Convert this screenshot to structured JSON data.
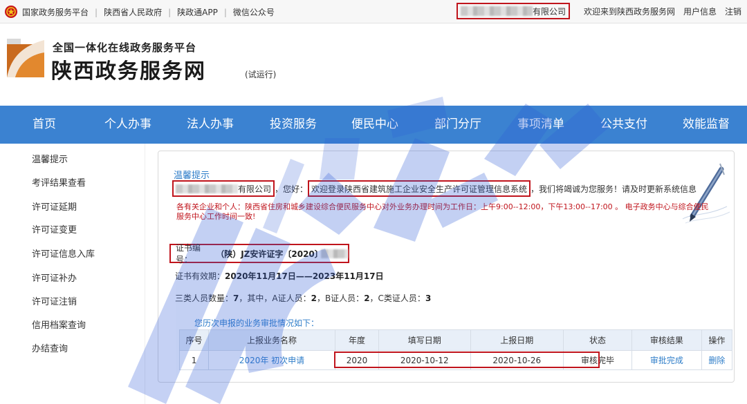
{
  "topbar": {
    "links": [
      "国家政务服务平台",
      "陕西省人民政府",
      "陕政通APP",
      "微信公众号"
    ],
    "company_suffix": "有限公司",
    "welcome": "欢迎来到陕西政务服务网",
    "user_info": "用户信息",
    "logout": "注销"
  },
  "header": {
    "slogan": "全国一体化在线政务服务平台",
    "site_name": "陕西政务服务网",
    "trial": "(试运行)"
  },
  "nav": {
    "items": [
      "首页",
      "个人办事",
      "法人办事",
      "投资服务",
      "便民中心",
      "部门分厅",
      "事项清单",
      "公共支付",
      "效能监督"
    ]
  },
  "sidebar": {
    "items": [
      "温馨提示",
      "考评结果查看",
      "许可证延期",
      "许可证变更",
      "许可证信息入库",
      "许可证补办",
      "许可证注销",
      "信用档案查询",
      "办结查询"
    ]
  },
  "panel": {
    "title": "温馨提示",
    "company_suffix": "有限公司",
    "greeting": "，您好：",
    "system_welcome": "欢迎登录陕西省建筑施工企业安全生产许可证管理信息系统",
    "service_text": "，我们将竭诚为您服务！请及时更新系统信息",
    "notice": "各有关企业和个人：陕西省住房和城乡建设综合便民服务中心对外业务办理时间为工作日：上午9:00--12:00，下午13:00--17:00 。 电子政务中心与综合便民服务中心工作时间一致!",
    "cert_label": "证书编号：",
    "cert_value": "（陕）JZ安许证字〔2020〕",
    "validity_label": "证书有效期：",
    "validity_value": "2020年11月17日——2023年11月17日",
    "staff_label": "三类人员数量：",
    "staff_total": "7",
    "staff_mid": "，其中，A证人员：",
    "staff_a": "2",
    "staff_b_label": "，B证人员：",
    "staff_b": "2",
    "staff_c_label": "，C类证人员：",
    "staff_c": "3",
    "history_title": "您历次申报的业务审批情况如下："
  },
  "table": {
    "headers": [
      "序号",
      "上报业务名称",
      "年度",
      "填写日期",
      "上报日期",
      "状态",
      "审核结果",
      "操作"
    ],
    "rows": [
      {
        "no": "1",
        "name": "2020年 初次申请",
        "year": "2020",
        "fill_date": "2020-10-12",
        "report_date": "2020-10-26",
        "status": "审核完毕",
        "result": "审批完成",
        "action": "删除"
      }
    ]
  },
  "colors": {
    "nav_bg": "#3b82d1",
    "highlight_red": "#c0141c",
    "link_blue": "#2f7ec9",
    "table_header_bg": "#e8eff8"
  }
}
